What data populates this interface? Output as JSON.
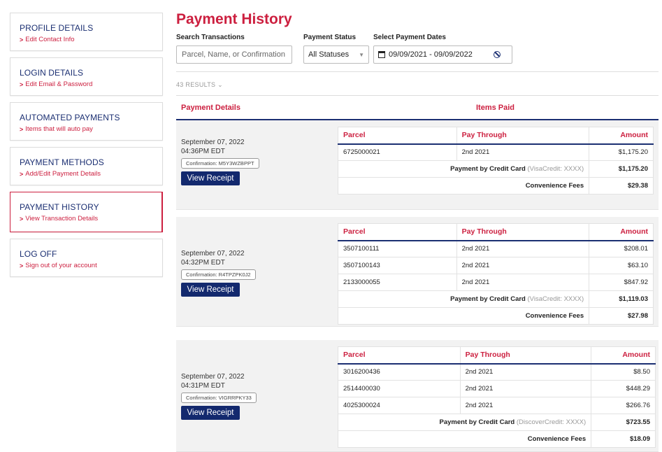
{
  "sidebar": {
    "items": [
      {
        "title": "PROFILE DETAILS",
        "link": "Edit Contact Info"
      },
      {
        "title": "LOGIN DETAILS",
        "link": "Edit Email & Password"
      },
      {
        "title": "AUTOMATED PAYMENTS",
        "link": "Items that will auto pay"
      },
      {
        "title": "PAYMENT METHODS",
        "link": "Add/Edit Payment Details"
      },
      {
        "title": "PAYMENT HISTORY",
        "link": "View Transaction Details"
      },
      {
        "title": "LOG OFF",
        "link": "Sign out of your account"
      }
    ]
  },
  "page": {
    "title": "Payment History"
  },
  "filters": {
    "search_label": "Search Transactions",
    "search_placeholder": "Parcel, Name, or Confirmation",
    "status_label": "Payment Status",
    "status_value": "All Statuses",
    "dates_label": "Select Payment Dates",
    "dates_value": "09/09/2021 - 09/09/2022"
  },
  "results": {
    "count_label": "43 RESULTS"
  },
  "columns": {
    "details": "Payment Details",
    "items": "Items Paid"
  },
  "table_headers": {
    "parcel": "Parcel",
    "pay_through": "Pay Through",
    "amount": "Amount"
  },
  "convenience_label": "Convenience Fees",
  "receipt_label": "View Receipt",
  "transactions": [
    {
      "date": "September 07, 2022",
      "time": "04:36PM EDT",
      "confirmation": "Confirmation: M5Y3WZBPPT",
      "rows": [
        {
          "parcel": "6725000021",
          "pay_through": "2nd 2021",
          "amount": "$1,175.20"
        }
      ],
      "payment_prefix": "Payment by Credit Card",
      "payment_card": "(VisaCredit: XXXX)",
      "payment_total": "$1,175.20",
      "fees": "$29.38"
    },
    {
      "date": "September 07, 2022",
      "time": "04:32PM EDT",
      "confirmation": "Confirmation: R4TPZPK0J2",
      "rows": [
        {
          "parcel": "3507100111",
          "pay_through": "2nd 2021",
          "amount": "$208.01"
        },
        {
          "parcel": "3507100143",
          "pay_through": "2nd 2021",
          "amount": "$63.10"
        },
        {
          "parcel": "2133000055",
          "pay_through": "2nd 2021",
          "amount": "$847.92"
        }
      ],
      "payment_prefix": "Payment by Credit Card",
      "payment_card": "(VisaCredit: XXXX)",
      "payment_total": "$1,119.03",
      "fees": "$27.98"
    },
    {
      "date": "September 07, 2022",
      "time": "04:31PM EDT",
      "confirmation": "Confirmation: VIGRRPKY33",
      "rows": [
        {
          "parcel": "3016200436",
          "pay_through": "2nd 2021",
          "amount": "$8.50"
        },
        {
          "parcel": "2514400030",
          "pay_through": "2nd 2021",
          "amount": "$448.29"
        },
        {
          "parcel": "4025300024",
          "pay_through": "2nd 2021",
          "amount": "$266.76"
        }
      ],
      "payment_prefix": "Payment by Credit Card",
      "payment_card": "(DiscoverCredit: XXXX)",
      "payment_total": "$723.55",
      "fees": "$18.09"
    }
  ]
}
